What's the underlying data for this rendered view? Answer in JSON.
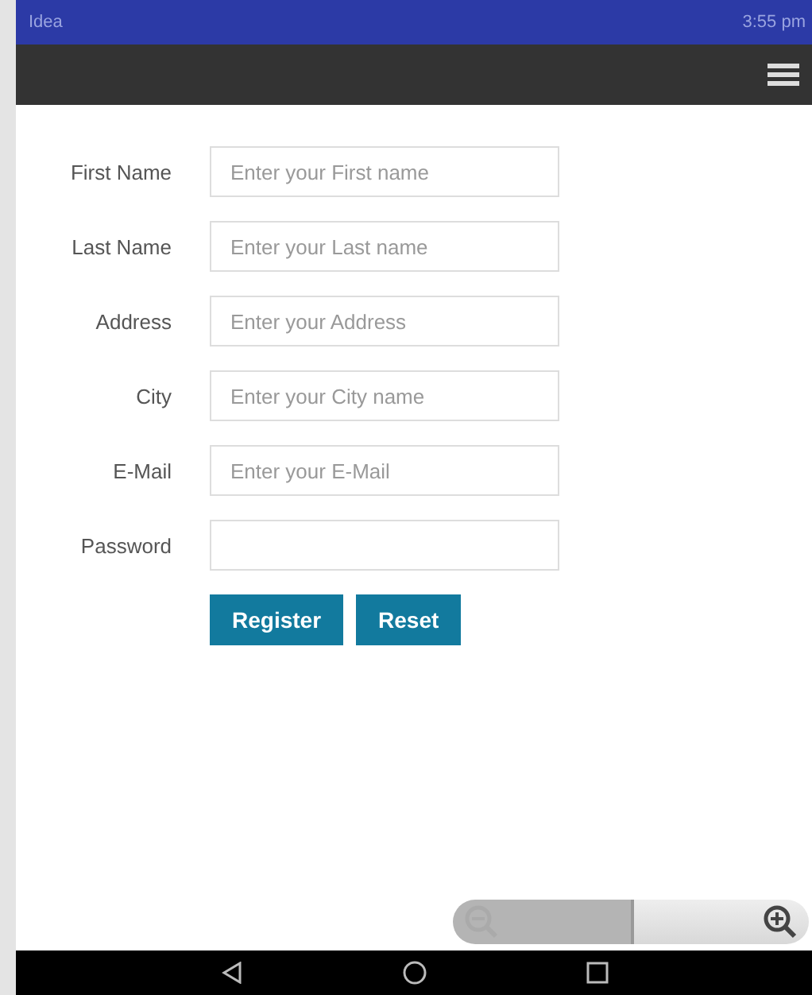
{
  "status_bar": {
    "carrier": "Idea",
    "time": "3:55 pm"
  },
  "form": {
    "fields": [
      {
        "label": "First Name",
        "placeholder": "Enter your First name"
      },
      {
        "label": "Last Name",
        "placeholder": "Enter your Last name"
      },
      {
        "label": "Address",
        "placeholder": "Enter your Address"
      },
      {
        "label": "City",
        "placeholder": "Enter your City name"
      },
      {
        "label": "E-Mail",
        "placeholder": "Enter your E-Mail"
      },
      {
        "label": "Password"
      }
    ],
    "buttons": [
      "Register",
      "Reset"
    ]
  },
  "zoom_controls": [
    {
      "kind": "out",
      "disabled": true
    },
    {
      "kind": "in",
      "disabled": false
    }
  ]
}
